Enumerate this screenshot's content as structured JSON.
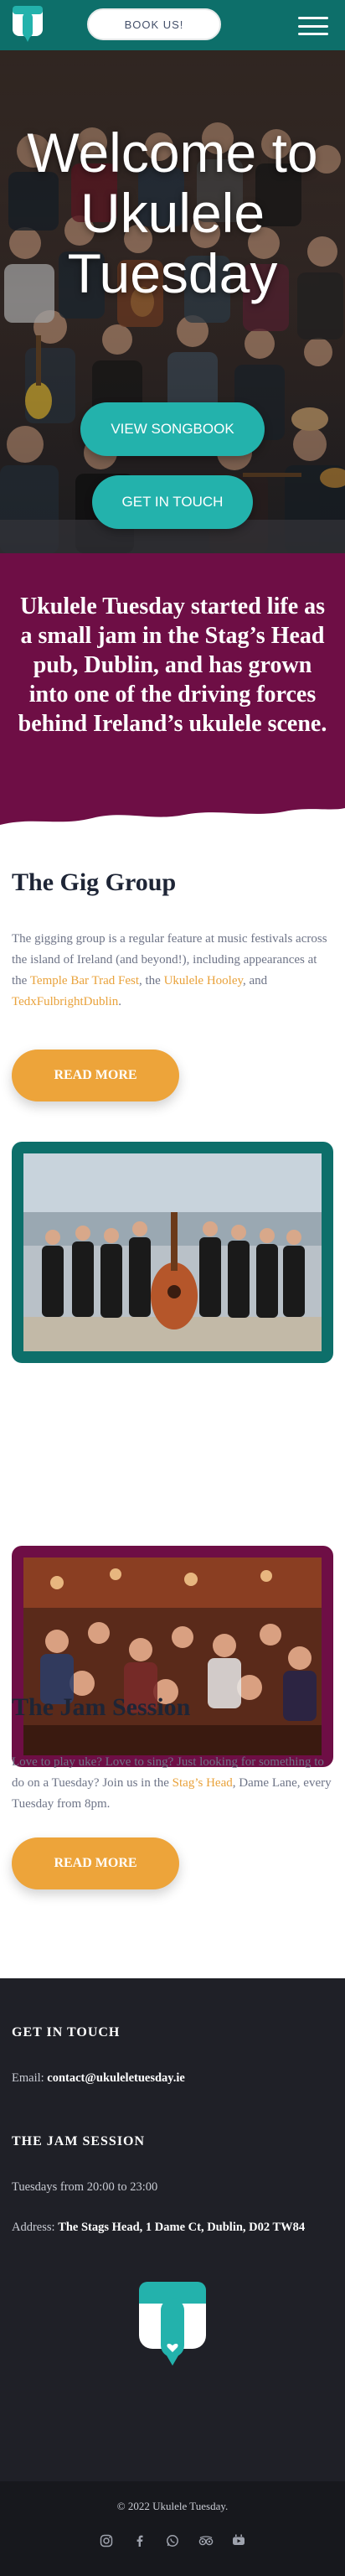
{
  "header": {
    "book_label": "BOOK US!",
    "menu_icon": "hamburger-menu-icon",
    "logo_icon": "ukulele-tuesday-logo"
  },
  "hero": {
    "title": "Welcome to Ukulele Tuesday",
    "songbook_label": "VIEW SONGBOOK",
    "touch_label": "GET IN TOUCH"
  },
  "intro": {
    "text": "Ukulele Tuesday started life as a small jam in the Stag’s Head pub, Dublin, and has grown into one of the driving forces behind Ireland’s ukulele scene."
  },
  "gig": {
    "title": "The Gig Group",
    "body_1": "The gigging group is a regular feature at music festivals across the island of Ireland (and beyond!), including appearances at the ",
    "link_1": "Temple Bar Trad Fest",
    "body_2": ", the ",
    "link_2": "Ukulele Hooley",
    "body_3": ", and ",
    "link_3": "TedxFulbrightDublin",
    "body_4": ".",
    "button": "READ MORE"
  },
  "jam": {
    "title": "The Jam Session",
    "body_1": "Love to play uke? Love to sing? Just looking for something to do on a Tuesday? Join us in the ",
    "link_1": "Stag’s Head",
    "body_2": ", Dame Lane, every Tuesday from 8pm.",
    "button": "READ MORE"
  },
  "footer": {
    "touch_heading": "GET IN TOUCH",
    "email_label": "Email: ",
    "email_value": "contact@ukuleletuesday.ie",
    "jam_heading": "THE JAM SESSION",
    "times": "Tuesdays from 20:00 to 23:00",
    "address_label": "Address: ",
    "address_value": "The Stags Head, 1 Dame Ct, Dublin, D02 TW84",
    "copyright": "© 2022 Ukulele Tuesday.",
    "social_icons": [
      "instagram-icon",
      "facebook-icon",
      "whatsapp-icon",
      "tripadvisor-icon",
      "youtube-icon"
    ]
  },
  "colors": {
    "teal": "#0d6f6a",
    "button_teal": "#23b2ac",
    "purple": "#6e0e45",
    "orange": "#eda43a",
    "dark": "#1f2027"
  }
}
